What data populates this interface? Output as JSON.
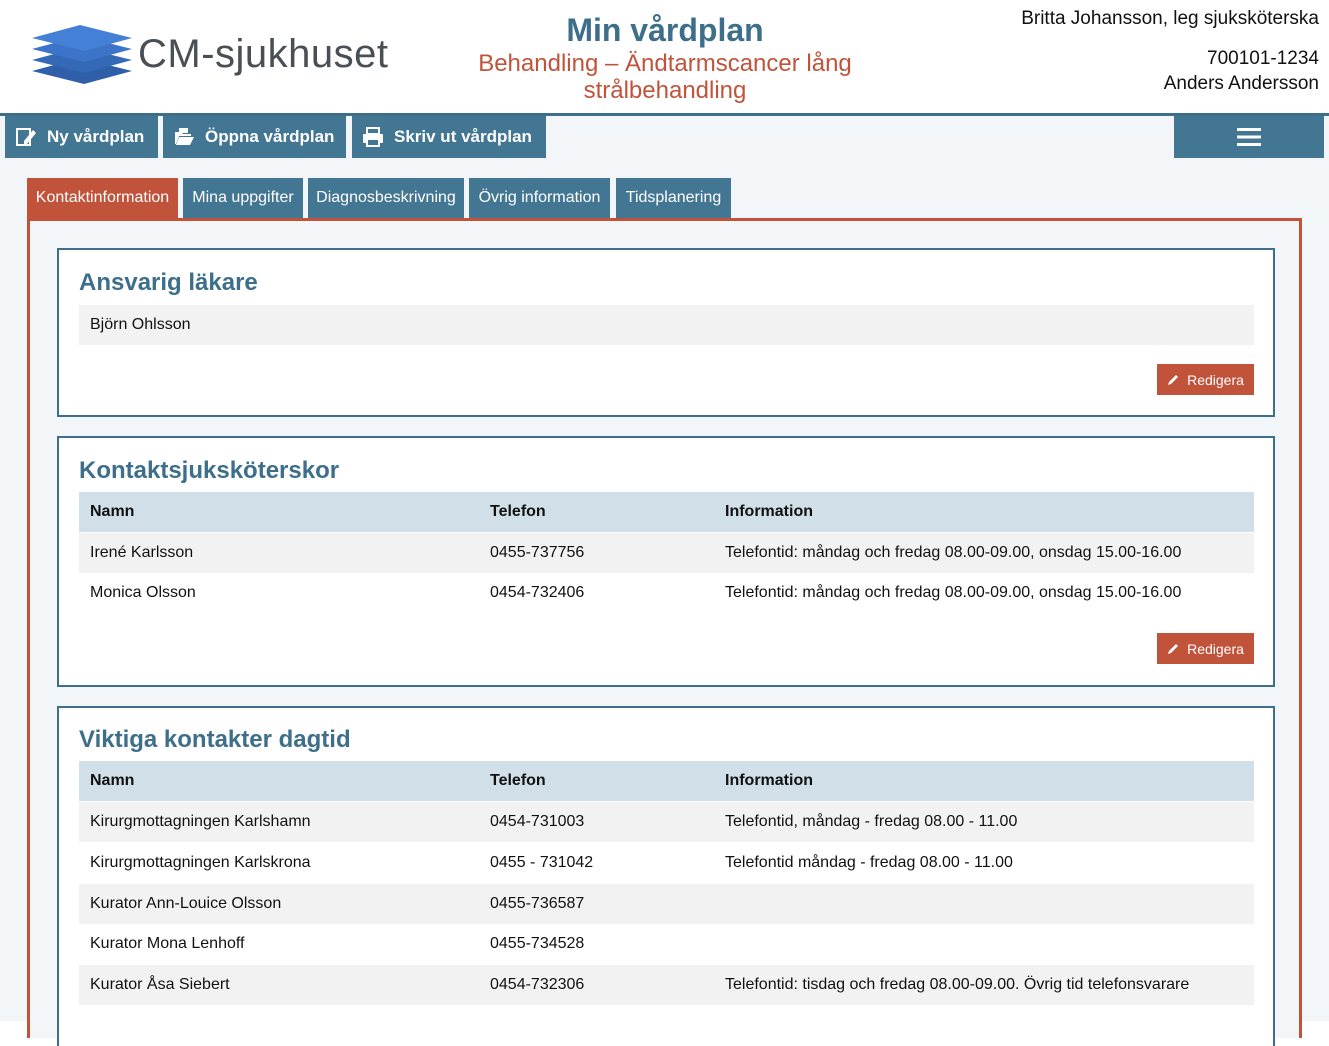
{
  "header": {
    "logo_text": "CM-sjukhuset",
    "title": "Min vårdplan",
    "subtitle": "Behandling – Ändtarmscancer lång strålbehandling",
    "staff": "Britta Johansson, leg sjuksköterska",
    "patient_id": "700101-1234",
    "patient_name": "Anders Andersson"
  },
  "toolbar": {
    "new_label": "Ny vårdplan",
    "open_label": "Öppna vårdplan",
    "print_label": "Skriv ut vårdplan"
  },
  "tabs": [
    {
      "label": "Kontaktinformation",
      "active": true
    },
    {
      "label": "Mina uppgifter",
      "active": false
    },
    {
      "label": "Diagnosbeskrivning",
      "active": false
    },
    {
      "label": "Övrig information",
      "active": false
    },
    {
      "label": "Tidsplanering",
      "active": false
    }
  ],
  "sections": {
    "doctor": {
      "title": "Ansvarig läkare",
      "name": "Björn Ohlsson",
      "edit_label": "Redigera"
    },
    "nurses": {
      "title": "Kontaktsjuksköterskor",
      "columns": [
        "Namn",
        "Telefon",
        "Information"
      ],
      "rows": [
        [
          "Irené Karlsson",
          "0455-737756",
          "Telefontid: måndag och fredag 08.00-09.00, onsdag 15.00-16.00"
        ],
        [
          "Monica Olsson",
          "0454-732406",
          "Telefontid: måndag och fredag 08.00-09.00, onsdag 15.00-16.00"
        ]
      ],
      "edit_label": "Redigera"
    },
    "contacts": {
      "title": "Viktiga kontakter dagtid",
      "columns": [
        "Namn",
        "Telefon",
        "Information"
      ],
      "rows": [
        [
          "Kirurgmottagningen Karlshamn",
          "0454-731003",
          "Telefontid, måndag - fredag 08.00 - 11.00"
        ],
        [
          "Kirurgmottagningen Karlskrona",
          "0455 - 731042",
          "Telefontid måndag - fredag 08.00 - 11.00"
        ],
        [
          "Kurator Ann-Louice Olsson",
          "0455-736587",
          ""
        ],
        [
          "Kurator Mona Lenhoff",
          "0455-734528",
          ""
        ],
        [
          "Kurator Åsa Siebert",
          "0454-732306",
          "Telefontid: tisdag och fredag 08.00-09.00. Övrig tid telefonsvarare"
        ]
      ]
    }
  },
  "colors": {
    "brand_blue": "#437693",
    "heading_blue": "#3d6f8a",
    "accent_red": "#c0533a"
  }
}
